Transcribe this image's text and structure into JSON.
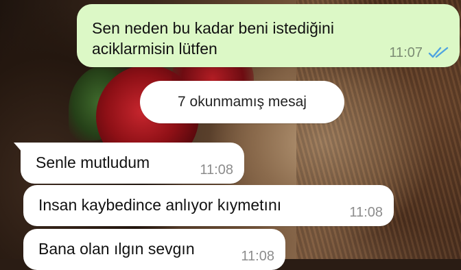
{
  "outgoing_message": {
    "text": "Sen neden bu kadar beni istediğini aciklarmisin lütfen",
    "time": "11:07",
    "status_icon": "double-check-read-icon",
    "bubble_color": "#dcf8c6",
    "tick_color": "#4fa3e0"
  },
  "unread_banner": {
    "label": "7 okunmamış mesaj"
  },
  "incoming_messages": [
    {
      "text": "Senle mutludum",
      "time": "11:08"
    },
    {
      "text": "Insan kaybedince anlıyor kıymetını",
      "time": "11:08"
    },
    {
      "text": "Bana olan ılgın sevgın",
      "time": "11:08"
    }
  ]
}
